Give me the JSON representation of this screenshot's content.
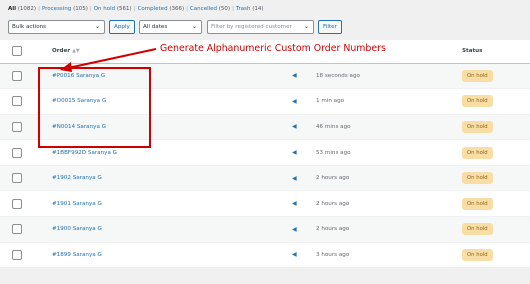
{
  "status_links": [
    {
      "label": "All",
      "count": "(1082)",
      "current": true
    },
    {
      "label": "Processing",
      "count": "(105)"
    },
    {
      "label": "On hold",
      "count": "(561)"
    },
    {
      "label": "Completed",
      "count": "(366)"
    },
    {
      "label": "Cancelled",
      "count": "(50)"
    },
    {
      "label": "Trash",
      "count": "(14)"
    }
  ],
  "toolbar": {
    "bulk_actions": "Bulk actions",
    "apply_label": "Apply",
    "dates": "All dates",
    "customer_placeholder": "Filter by registered customer",
    "filter_label": "Filter"
  },
  "table": {
    "headers": {
      "order": "Order",
      "date": "Date",
      "status": "Status"
    },
    "rows": [
      {
        "order": "#P0016 Saranya G",
        "date": "18 seconds ago",
        "status": "On hold"
      },
      {
        "order": "#O0015 Saranya G",
        "date": "1 min ago",
        "status": "On hold"
      },
      {
        "order": "#N0014 Saranya G",
        "date": "46 mins ago",
        "status": "On hold"
      },
      {
        "order": "#1BBF992D Saranya G",
        "date": "53 mins ago",
        "status": "On hold"
      },
      {
        "order": "#1902 Saranya G",
        "date": "2 hours ago",
        "status": "On hold"
      },
      {
        "order": "#1901 Saranya G",
        "date": "2 hours ago",
        "status": "On hold"
      },
      {
        "order": "#1900 Saranya G",
        "date": "2 hours ago",
        "status": "On hold"
      },
      {
        "order": "#1899 Saranya G",
        "date": "3 hours ago",
        "status": "On hold"
      }
    ]
  },
  "annotation": {
    "text": "Generate Alphanumeric Custom Order Numbers"
  },
  "colors": {
    "link": "#2271b1",
    "badge_bg": "#f8dda7",
    "badge_text": "#94660c",
    "annotation": "#d10000"
  },
  "icons": {
    "preview": "eye-icon",
    "sort": "sort-icon",
    "chevron": "chevron-down-icon"
  }
}
